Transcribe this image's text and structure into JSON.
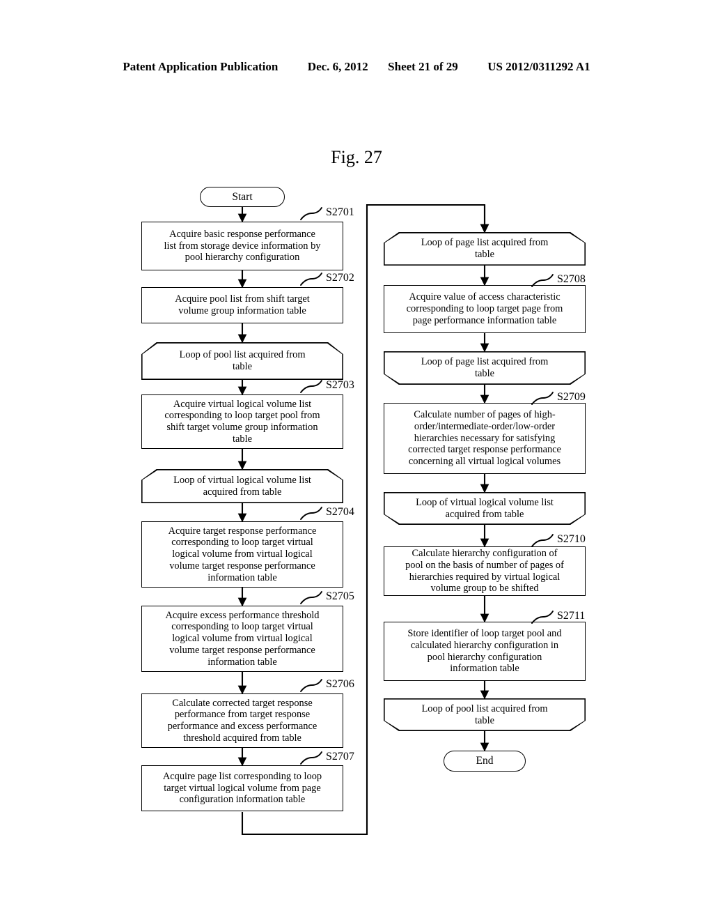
{
  "header": {
    "publication": "Patent Application Publication",
    "date": "Dec. 6, 2012",
    "sheet": "Sheet 21 of 29",
    "number": "US 2012/0311292 A1"
  },
  "figure": {
    "title": "Fig. 27"
  },
  "flowchart": {
    "start_label": "Start",
    "end_label": "End",
    "left_column": [
      {
        "id": "s2701",
        "step": "S2701",
        "shape": "process",
        "text": "Acquire basic response performance\nlist from storage device information by\npool hierarchy configuration"
      },
      {
        "id": "s2702",
        "step": "S2702",
        "shape": "process",
        "text": "Acquire pool list from shift target\nvolume group information table"
      },
      {
        "id": "loop-pool-start",
        "step": "",
        "shape": "loop-start",
        "text": "Loop of pool list acquired from\ntable"
      },
      {
        "id": "s2703",
        "step": "S2703",
        "shape": "process",
        "text": "Acquire virtual logical volume list\ncorresponding to loop target pool from\nshift target volume group information\ntable"
      },
      {
        "id": "loop-vlv-start",
        "step": "",
        "shape": "loop-start",
        "text": "Loop of virtual logical volume list\nacquired from table"
      },
      {
        "id": "s2704",
        "step": "S2704",
        "shape": "process",
        "text": "Acquire target response performance\ncorresponding to loop target virtual\nlogical volume from virtual logical\nvolume target response performance\ninformation table"
      },
      {
        "id": "s2705",
        "step": "S2705",
        "shape": "process",
        "text": "Acquire excess performance threshold\ncorresponding to loop target virtual\nlogical volume from virtual logical\nvolume target response performance\ninformation table"
      },
      {
        "id": "s2706",
        "step": "S2706",
        "shape": "process",
        "text": "Calculate corrected target response\nperformance from target response\nperformance and excess performance\nthreshold acquired from table"
      },
      {
        "id": "s2707",
        "step": "S2707",
        "shape": "process",
        "text": "Acquire page list corresponding to loop\ntarget virtual logical volume from page\nconfiguration information table"
      }
    ],
    "right_column": [
      {
        "id": "loop-page-start",
        "step": "",
        "shape": "loop-start",
        "text": "Loop of page list acquired from\ntable"
      },
      {
        "id": "s2708",
        "step": "S2708",
        "shape": "process",
        "text": "Acquire value of access characteristic\ncorresponding to loop target page from\npage performance information table"
      },
      {
        "id": "loop-page-end",
        "step": "",
        "shape": "loop-end",
        "text": "Loop of page list acquired from\ntable"
      },
      {
        "id": "s2709",
        "step": "S2709",
        "shape": "process",
        "text": "Calculate number of pages of high-\norder/intermediate-order/low-order\nhierarchies necessary for satisfying\ncorrected target response performance\nconcerning all virtual logical volumes"
      },
      {
        "id": "loop-vlv-end",
        "step": "",
        "shape": "loop-end",
        "text": "Loop of virtual logical volume list\nacquired from table"
      },
      {
        "id": "s2710",
        "step": "S2710",
        "shape": "process",
        "text": "Calculate hierarchy configuration of\npool on the basis of number of pages of\nhierarchies required by virtual logical\nvolume group to be shifted"
      },
      {
        "id": "s2711",
        "step": "S2711",
        "shape": "process",
        "text": "Store identifier of loop target pool and\ncalculated hierarchy configuration in\npool hierarchy configuration\ninformation table"
      },
      {
        "id": "loop-pool-end",
        "step": "",
        "shape": "loop-end",
        "text": "Loop of pool list acquired from\ntable"
      }
    ]
  }
}
